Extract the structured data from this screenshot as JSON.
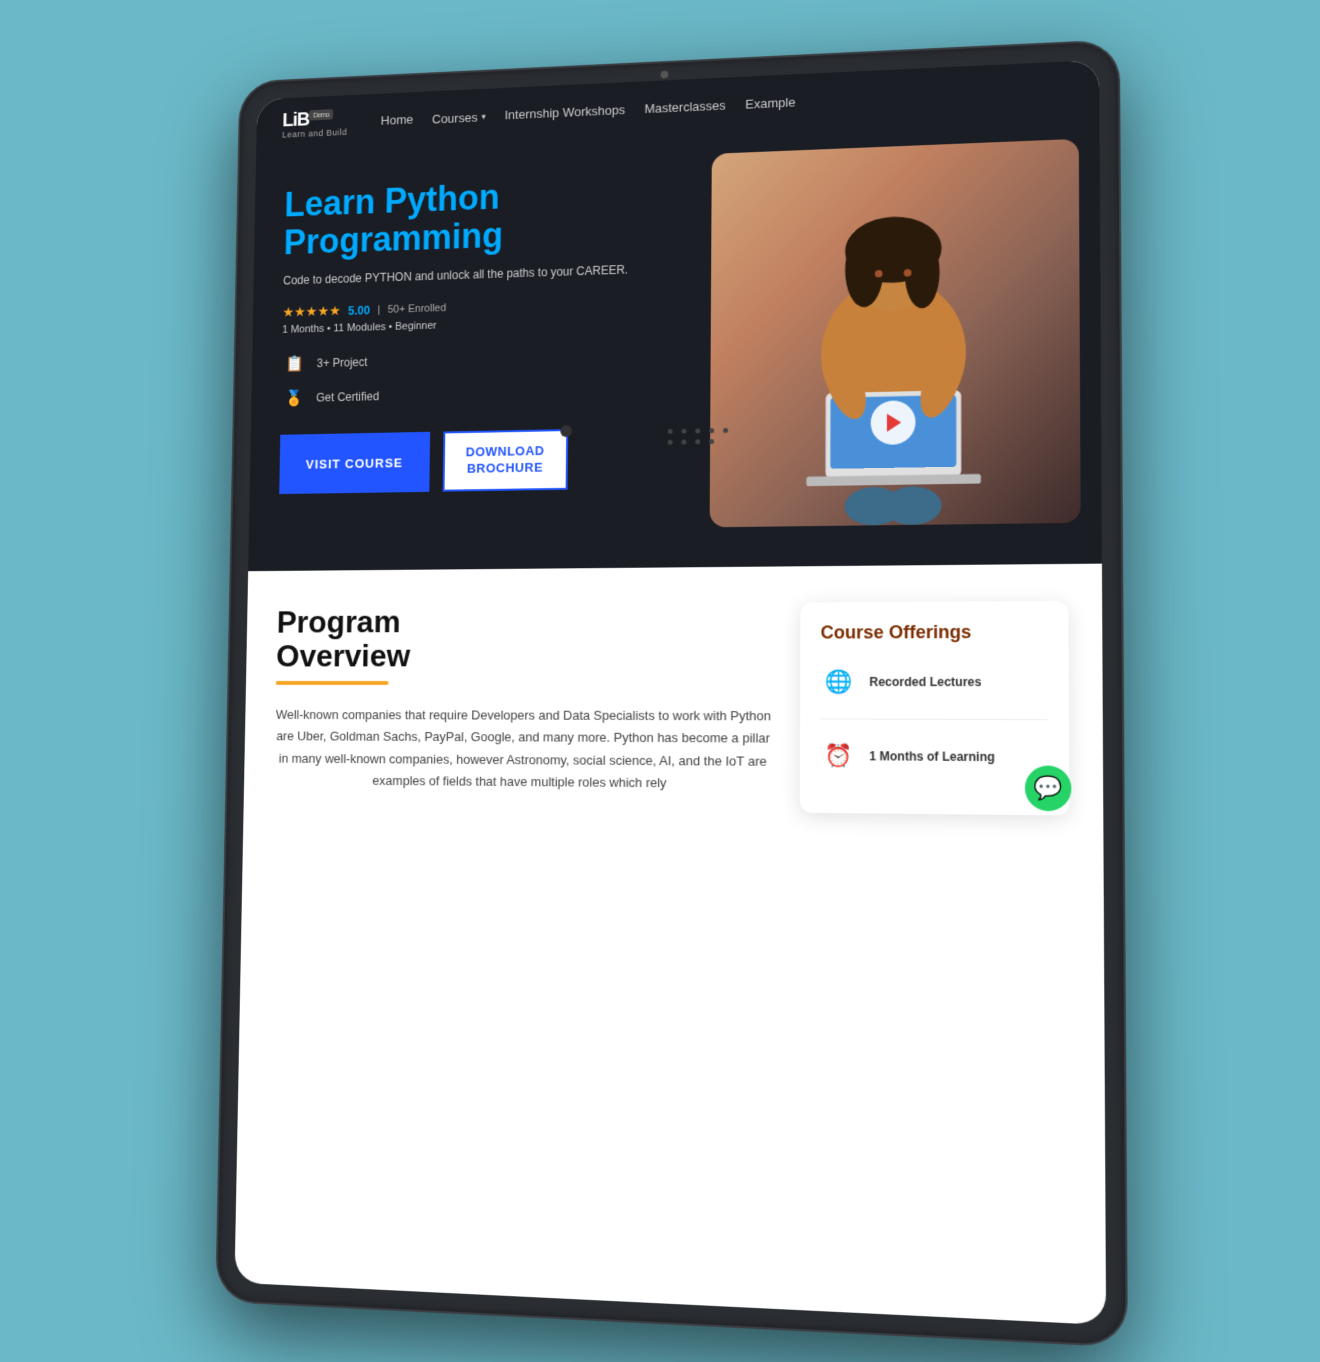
{
  "tablet": {
    "camera": "camera"
  },
  "navbar": {
    "logo_text": "LiB",
    "logo_demo": "Demo",
    "logo_sub": "Learn and Build",
    "links": [
      {
        "label": "Home",
        "id": "home"
      },
      {
        "label": "Courses",
        "id": "courses",
        "has_dropdown": true
      },
      {
        "label": "Internship Workshops",
        "id": "internship"
      },
      {
        "label": "Masterclasses",
        "id": "masterclasses"
      },
      {
        "label": "Example",
        "id": "example"
      }
    ]
  },
  "hero": {
    "title_line1": "Learn Python",
    "title_line2": "Programming",
    "subtitle": "Code to decode PYTHON and unlock all the paths to your CAREER.",
    "rating_score": "5.00",
    "rating_separator": "|",
    "enrolled": "50+ Enrolled",
    "course_meta": "1 Months • 11 Modules • Beginner",
    "features": [
      {
        "icon": "📋",
        "label": "3+ Project"
      },
      {
        "icon": "🏅",
        "label": "Get Certified"
      }
    ],
    "btn_visit": "VISIT COURSE",
    "btn_download_line1": "DOWNLOAD",
    "btn_download_line2": "BROCHURE"
  },
  "lower": {
    "program_title_line1": "Program",
    "program_title_line2": "Overview",
    "program_text": "Well-known companies that require Developers and Data Specialists to work with Python are Uber, Goldman Sachs, PayPal, Google, and many more. Python has become a pillar in many well-known companies, however Astronomy, social science, AI, and the IoT are examples of fields that have multiple roles which rely",
    "offerings": {
      "title": "Course Offerings",
      "items": [
        {
          "icon": "🌐",
          "label": "Recorded Lectures"
        },
        {
          "icon": "⏰",
          "label": "1 Months of Learning"
        }
      ]
    }
  },
  "colors": {
    "accent_blue": "#00aaff",
    "nav_bg": "#1a1d24",
    "btn_blue": "#2255ff",
    "star_gold": "#f5a623",
    "underline_yellow": "#f5a623",
    "offerings_title": "#7b2d00",
    "whatsapp_green": "#25d366"
  }
}
